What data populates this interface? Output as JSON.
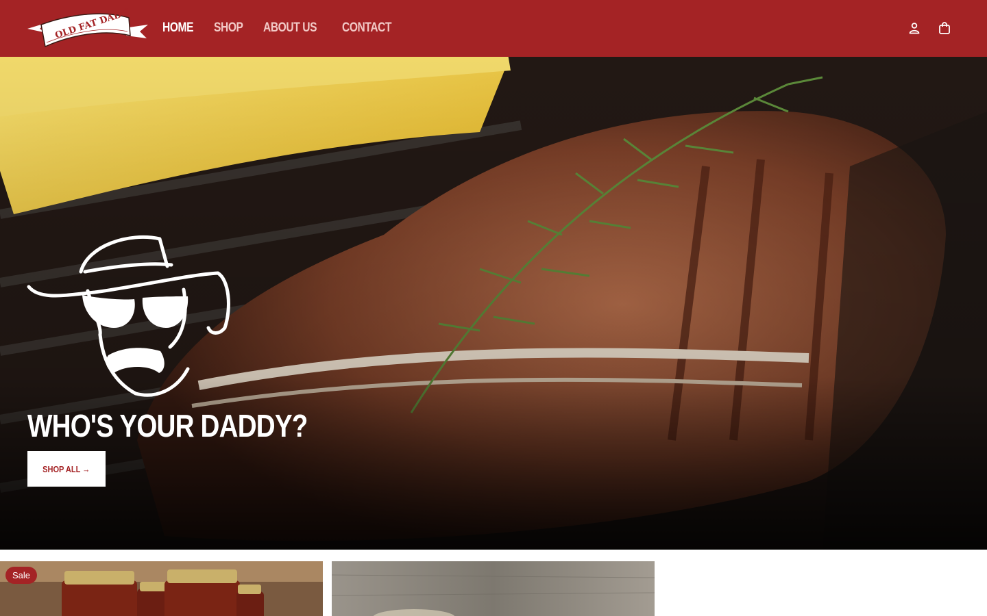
{
  "header": {
    "logo_text": "OLD FAT DAD'S",
    "nav": [
      {
        "label": "HOME",
        "active": true
      },
      {
        "label": "SHOP",
        "active": false
      },
      {
        "label": "ABOUT US",
        "active": false
      },
      {
        "label": "CONTACT",
        "active": false
      }
    ],
    "icons": [
      "account-icon",
      "cart-icon"
    ]
  },
  "hero": {
    "title": "WHO'S YOUR DADDY?",
    "button_label": "SHOP ALL →"
  },
  "products": {
    "cards": [
      {
        "badge": "Sale"
      },
      {
        "badge": ""
      }
    ]
  },
  "colors": {
    "brand_red": "#a42325",
    "white": "#ffffff"
  }
}
